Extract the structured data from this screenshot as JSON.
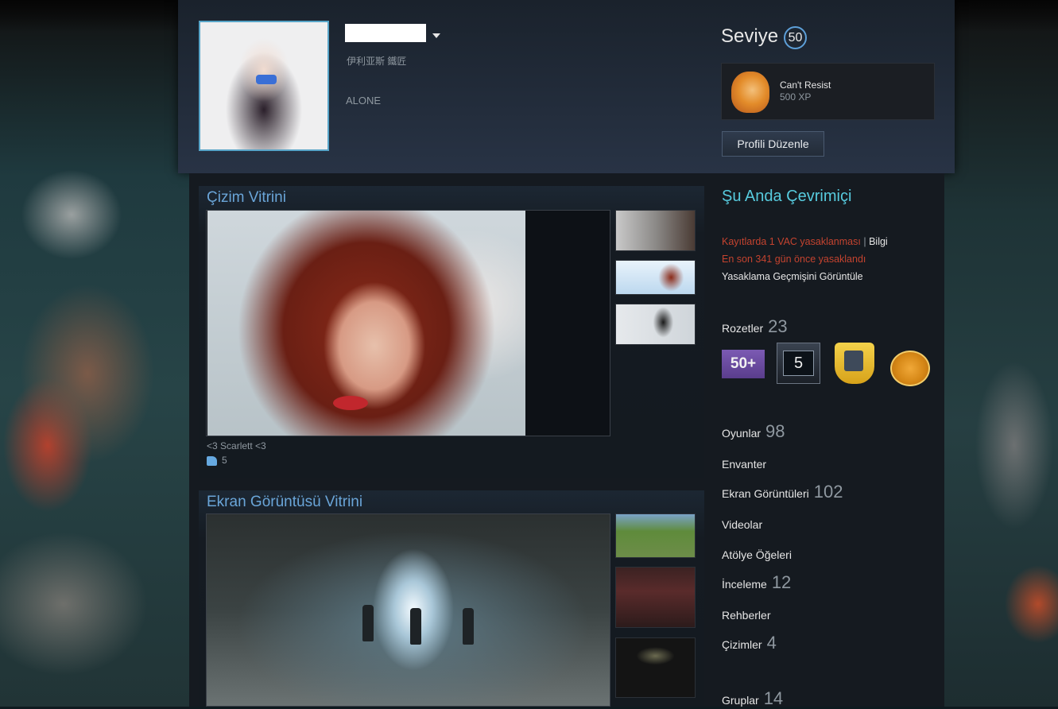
{
  "header": {
    "realname": "伊利亚斯 鐵匠",
    "summary": "ALONE",
    "level_label": "Seviye",
    "level_value": "50",
    "favorite_badge": {
      "name": "Can't Resist",
      "xp": "500 XP"
    },
    "edit_button": "Profili Düzenle"
  },
  "showcases": [
    {
      "title": "Çizim Vitrini",
      "caption": "<3 Scarlett <3",
      "likes": "5"
    },
    {
      "title": "Ekran Görüntüsü Vitrini"
    }
  ],
  "sidebar": {
    "status": "Şu Anda Çevrimiçi",
    "vac_line": "Kayıtlarda 1 VAC yasaklanması",
    "vac_separator": "|",
    "vac_info_link": "Bilgi",
    "vac_last": "En son 341 gün önce yasaklandı",
    "ban_history_link": "Yasaklama Geçmişini Görüntüle",
    "badges": {
      "label": "Rozetler",
      "count": "23",
      "items": [
        "50+",
        "5"
      ]
    },
    "stats": [
      {
        "label": "Oyunlar",
        "count": "98"
      },
      {
        "label": "Envanter",
        "count": ""
      },
      {
        "label": "Ekran Görüntüleri",
        "count": "102"
      },
      {
        "label": "Videolar",
        "count": ""
      },
      {
        "label": "Atölye Öğeleri",
        "count": ""
      },
      {
        "label": "İnceleme",
        "count": "12"
      },
      {
        "label": "Rehberler",
        "count": ""
      },
      {
        "label": "Çizimler",
        "count": "4"
      },
      {
        "label": "Gruplar",
        "count": "14"
      }
    ]
  }
}
